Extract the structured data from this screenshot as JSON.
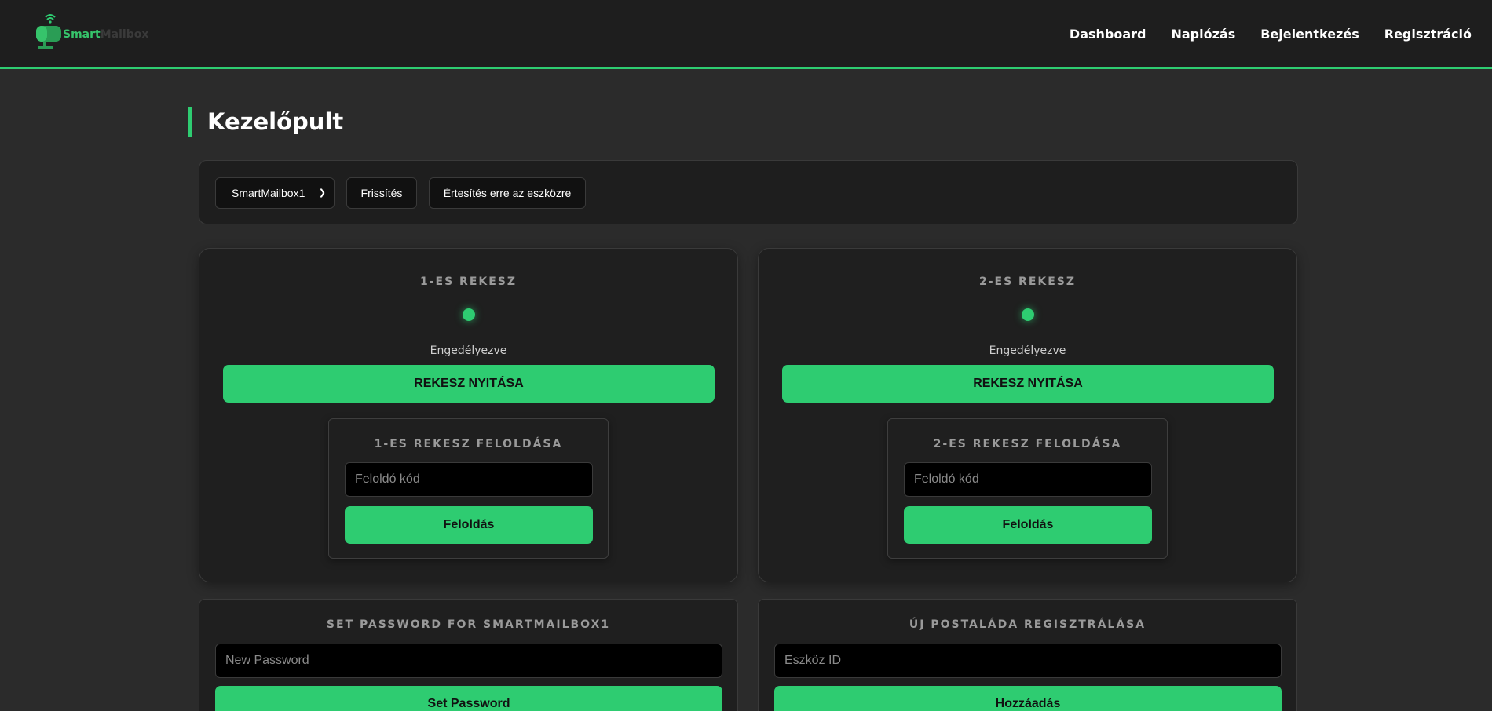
{
  "brand": {
    "part1": "Smart",
    "part2": "Mailbox"
  },
  "nav": {
    "items": [
      "Dashboard",
      "Naplózás",
      "Bejelentkezés",
      "Regisztráció"
    ]
  },
  "page": {
    "title": "Kezelőpult"
  },
  "toolbar": {
    "device_select": {
      "selected": "SmartMailbox1"
    },
    "refresh_label": "Frissítés",
    "notify_label": "Értesítés erre az eszközre"
  },
  "compartments": [
    {
      "title": "1-ES REKESZ",
      "status": "Engedélyezve",
      "open_label": "REKESZ NYITÁSA",
      "unlock": {
        "title": "1-ES REKESZ FELOLDÁSA",
        "placeholder": "Feloldó kód",
        "button": "Feloldás"
      }
    },
    {
      "title": "2-ES REKESZ",
      "status": "Engedélyezve",
      "open_label": "REKESZ NYITÁSA",
      "unlock": {
        "title": "2-ES REKESZ FELOLDÁSA",
        "placeholder": "Feloldó kód",
        "button": "Feloldás"
      }
    }
  ],
  "set_password": {
    "title": "SET PASSWORD FOR SMARTMAILBOX1",
    "placeholder": "New Password",
    "button": "Set Password"
  },
  "register_mailbox": {
    "title": "ÚJ POSTALÁDA REGISZTRÁLÁSA",
    "placeholder": "Eszköz ID",
    "button": "Hozzáadás"
  },
  "colors": {
    "accent": "#2ecc71",
    "background": "#2b2b2b",
    "card": "#1f1f1f"
  }
}
